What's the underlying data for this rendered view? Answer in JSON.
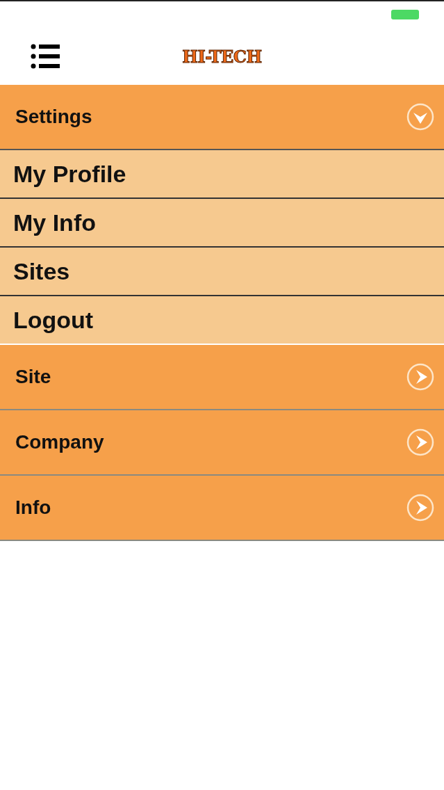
{
  "header": {
    "logo": "HI-TECH"
  },
  "menu": [
    {
      "label": "Settings",
      "expanded": true,
      "items": [
        "My Profile",
        "My Info",
        "Sites",
        "Logout"
      ]
    },
    {
      "label": "Site",
      "expanded": false
    },
    {
      "label": "Company",
      "expanded": false
    },
    {
      "label": "Info",
      "expanded": false
    }
  ]
}
